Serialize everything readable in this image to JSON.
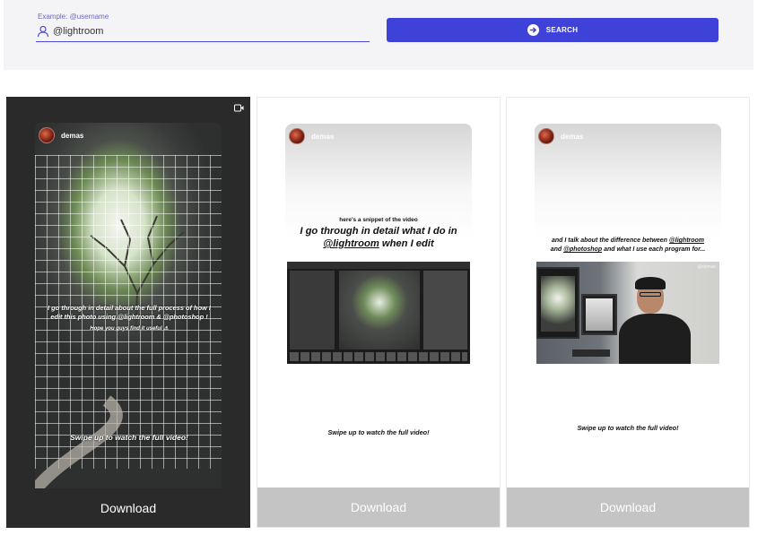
{
  "search": {
    "placeholder": "Example: @username",
    "value": "@lightroom",
    "button_label": "SEARCH",
    "accent_color": "#3f42d9"
  },
  "stories": [
    {
      "username": "demas",
      "media_icon": "video-camera-icon",
      "caption_main": "I go through in detail about the full process of how I edit this photo using @lightroom & @photoshop !",
      "caption_sub": "Hope you guys find it useful ⚠",
      "caption_swipe": "Swipe up to watch the full video!",
      "download_label": "Download"
    },
    {
      "username": "demas",
      "caption_small": "here's a snippet of the video",
      "caption_big_pre": "I go through in detail what I do in",
      "caption_big_handle": "@lightroom",
      "caption_big_post": "when I edit",
      "caption_swipe": "Swipe up to watch the full video!",
      "download_label": "Download"
    },
    {
      "username": "demas",
      "caption_pre": "and I talk about the difference between",
      "caption_handle1": "@lightroom",
      "caption_mid": "and",
      "caption_handle2": "@photoshop",
      "caption_post": "and what I use each program for...",
      "watermark": "@demas",
      "caption_swipe": "Swipe up to watch the full video!",
      "download_label": "Download"
    }
  ]
}
